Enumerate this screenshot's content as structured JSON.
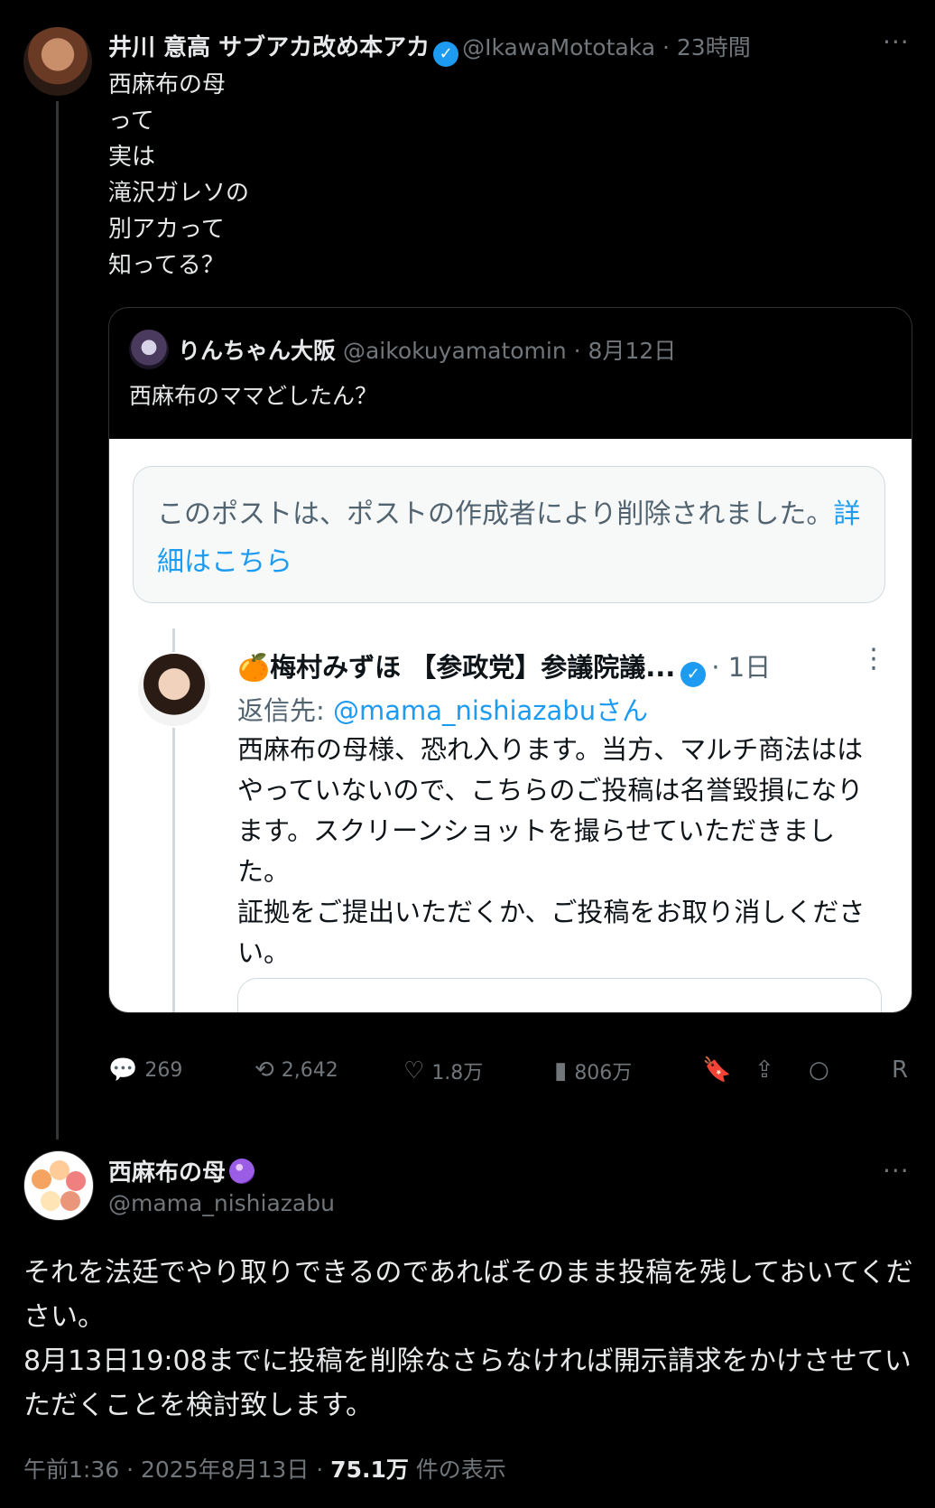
{
  "first_tweet": {
    "name": "井川 意高 サブアカ改め本アカ",
    "handle": "@IkawaMototaka",
    "time": "23時間",
    "more": "···",
    "text": "西麻布の母\nって\n実は\n滝沢ガレソの\n別アカって\n知ってる？",
    "quote": {
      "name": "りんちゃん大阪",
      "handle": "@aikokuyamatomin",
      "time": "8月12日",
      "text": "西麻布のママどしたん？",
      "screenshot": {
        "deleted_text": "このポストは、ポストの作成者により削除されました。",
        "deleted_link": "詳細はこちら",
        "user_name": "🍊梅村みずほ 【参政党】参議院議...",
        "user_time": "1日",
        "reply_label": "返信先: ",
        "reply_to": "@mama_nishiazabuさん",
        "text": "西麻布の母様、恐れ入ります。当方、マルチ商法ははやっていないので、こちらのご投稿は名誉毀損になります。スクリーンショットを撮らせていただきました。\n証拠をご提出いただくか、ご投稿をお取り消しください。"
      }
    },
    "actions": {
      "replies": "269",
      "reposts": "2,642",
      "likes": "1.8万",
      "views": "806万",
      "extra": "R"
    }
  },
  "second_tweet": {
    "name": "西麻布の母",
    "handle": "@mama_nishiazabu",
    "more": "···",
    "text": "それを法廷でやり取りできるのであればそのまま投稿を残しておいてください。\n8月13日19:08までに投稿を削除なさらなければ開示請求をかけさせていただくことを検討致します。",
    "meta_time": "午前1:36 · 2025年8月13日 · ",
    "meta_views": "75.1万",
    "meta_views_label": " 件の表示"
  }
}
